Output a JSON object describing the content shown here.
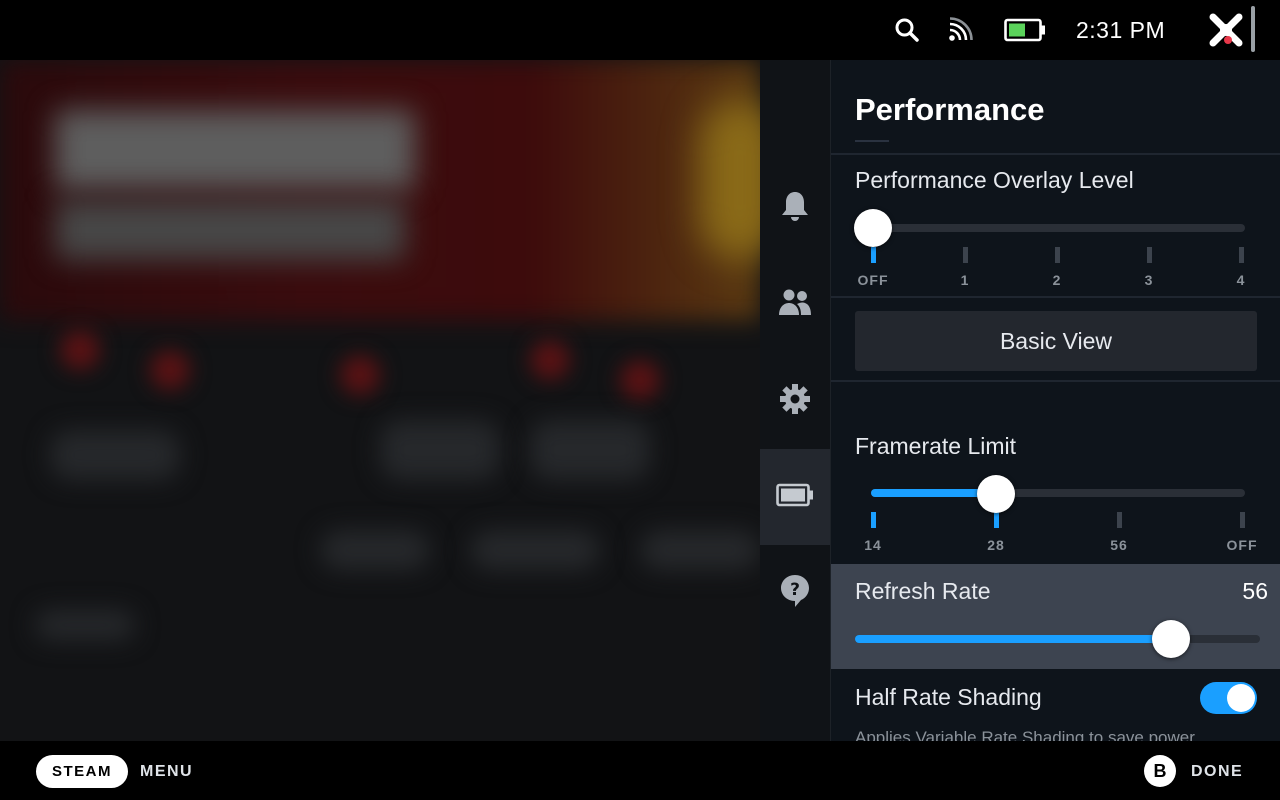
{
  "status_bar": {
    "time": "2:31 PM",
    "battery_level": 0.55,
    "icons": [
      "search-icon",
      "wifi-icon",
      "battery-icon",
      "steam-logo-icon"
    ]
  },
  "quick_access": {
    "items": [
      {
        "name": "notifications",
        "icon": "bell-icon"
      },
      {
        "name": "friends",
        "icon": "friends-icon"
      },
      {
        "name": "settings",
        "icon": "gear-icon"
      },
      {
        "name": "performance",
        "icon": "battery-icon",
        "active": true
      },
      {
        "name": "help",
        "icon": "help-icon"
      }
    ]
  },
  "panel": {
    "title": "Performance",
    "overlay": {
      "label": "Performance Overlay Level",
      "ticks": [
        "OFF",
        "1",
        "2",
        "3",
        "4"
      ],
      "selected_index": 0
    },
    "basic_view_label": "Basic View",
    "framerate": {
      "label": "Framerate Limit",
      "ticks": [
        "14",
        "28",
        "56",
        "OFF"
      ],
      "selected_index": 1
    },
    "refresh_rate": {
      "label": "Refresh Rate",
      "value": "56",
      "fraction": 0.78
    },
    "half_rate_shading": {
      "label": "Half Rate Shading",
      "enabled": true,
      "description": "Applies Variable Rate Shading to save power"
    }
  },
  "bottom_bar": {
    "steam_label": "STEAM",
    "menu_label": "MENU",
    "b_label": "B",
    "done_label": "DONE"
  },
  "colors": {
    "accent": "#1a9fff",
    "panel_bg": "#0e141b",
    "highlight_row": "#3d4450"
  }
}
